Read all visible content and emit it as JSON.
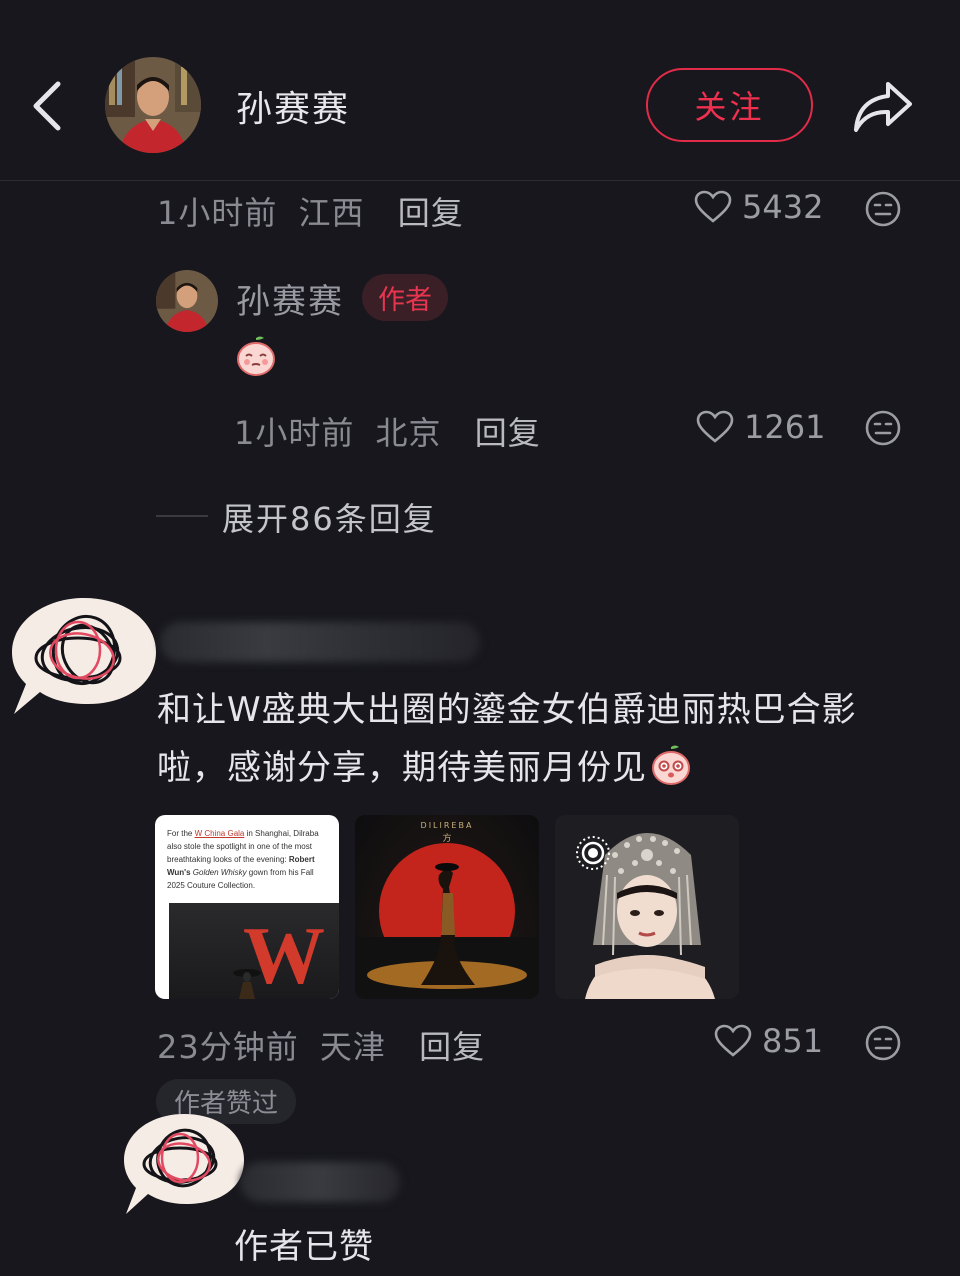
{
  "header": {
    "username": "孙赛赛",
    "follow_label": "关注"
  },
  "comment1": {
    "time": "1小时前",
    "location": "江西",
    "reply_label": "回复",
    "likes": "5432"
  },
  "reply1": {
    "username": "孙赛赛",
    "badge": "作者",
    "time": "1小时前",
    "location": "北京",
    "reply_label": "回复",
    "likes": "1261"
  },
  "expand_label": "展开86条回复",
  "comment2": {
    "text_line1": "和让W盛典大出圈的鎏金女伯爵迪丽热巴合影",
    "text_line2": "啦，感谢分享，期待美丽月份见",
    "image1": {
      "caption_parts": [
        "For the ",
        "W China Gala",
        " in Shanghai, Dilraba also stole the spotlight in one of the most breathtaking looks of the evening: ",
        "Robert Wun's ",
        "Golden Whisky",
        " gown from his Fall 2025 Couture Collection."
      ],
      "logo_letter": "W"
    },
    "image2": {
      "title": "DILIREBA",
      "subtitle": "方"
    },
    "time": "23分钟前",
    "location": "天津",
    "reply_label": "回复",
    "likes": "851",
    "author_liked": "作者赞过"
  },
  "comment3": {
    "text": "作者已赞"
  },
  "colors": {
    "background": "#17171d",
    "accent_red": "#f0304f",
    "muted_text": "#8a8a93"
  }
}
